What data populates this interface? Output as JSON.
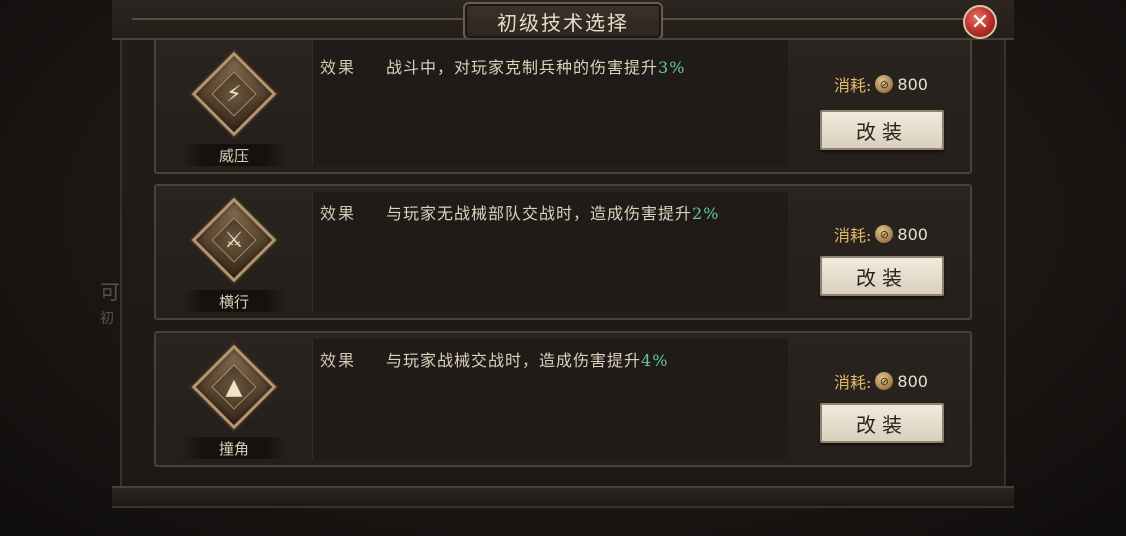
{
  "dialog": {
    "title": "初级技术选择",
    "close_glyph": "✕"
  },
  "background": {
    "text_a": "可",
    "text_b": "初"
  },
  "cards": [
    {
      "name": "威压",
      "icon": "shield-bolt-icon",
      "glyph": "⚡",
      "effect_label": "效果",
      "effect_text": "战斗中，对玩家克制兵种的伤害提升",
      "effect_pct": "3%",
      "cost_label": "消耗:",
      "cost_value": "800",
      "button_label": "改装"
    },
    {
      "name": "横行",
      "icon": "crossed-blades-icon",
      "glyph": "⚔",
      "effect_label": "效果",
      "effect_text": "与玩家无战械部队交战时，造成伤害提升",
      "effect_pct": "2%",
      "cost_label": "消耗:",
      "cost_value": "800",
      "button_label": "改装"
    },
    {
      "name": "撞角",
      "icon": "ram-spike-icon",
      "glyph": "▲",
      "effect_label": "效果",
      "effect_text": "与玩家战械交战时，造成伤害提升",
      "effect_pct": "4%",
      "cost_label": "消耗:",
      "cost_value": "800",
      "button_label": "改装"
    }
  ],
  "colors": {
    "accent_green": "#66c79a",
    "cost_gold": "#e2b869",
    "close_red": "#b42e28"
  }
}
